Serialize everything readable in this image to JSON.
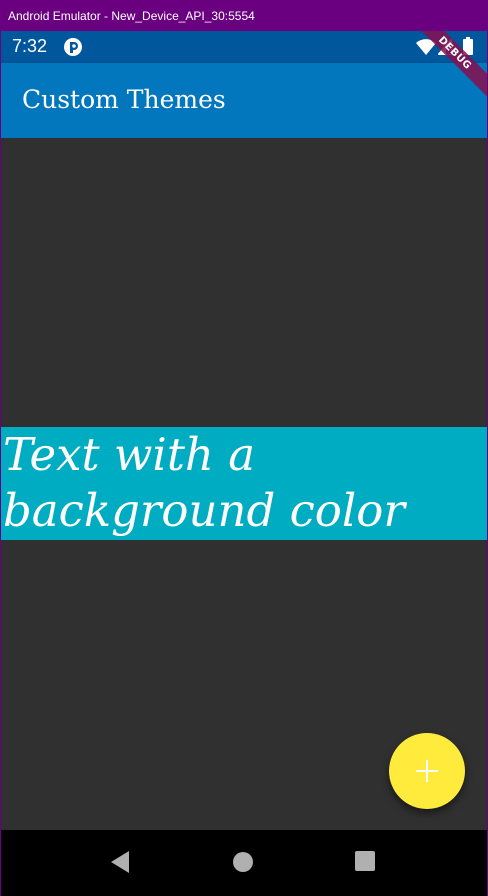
{
  "window": {
    "title": "Android Emulator - New_Device_API_30:5554"
  },
  "status_bar": {
    "time": "7:32",
    "icons": [
      "app-notification-icon",
      "wifi-icon",
      "signal-icon",
      "battery-icon"
    ]
  },
  "app_bar": {
    "title": "Custom Themes"
  },
  "debug_banner": {
    "label": "DEBUG"
  },
  "content": {
    "highlight_text": "Text with a background color"
  },
  "fab": {
    "icon": "plus-icon"
  },
  "nav_bar": {
    "buttons": [
      "back-icon",
      "home-icon",
      "recents-icon"
    ]
  },
  "colors": {
    "window_frame": "#6a0080",
    "status_bar": "#01579b",
    "app_bar": "#0277bd",
    "background": "#303030",
    "text_background": "#00acc1",
    "fab": "#ffeb3b",
    "debug_banner": "#880e4f",
    "nav_bar": "#000000"
  }
}
